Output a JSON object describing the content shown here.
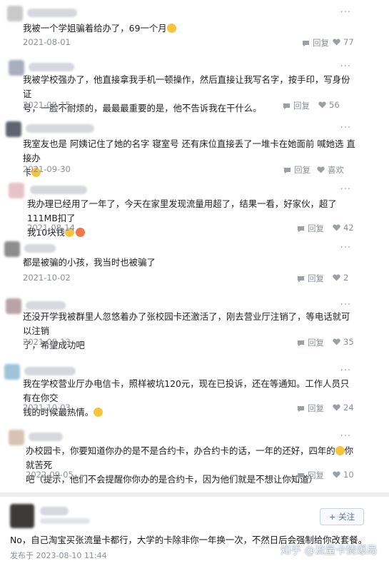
{
  "comments": [
    {
      "text": "我被一个学姐骗着给办了，69一个月",
      "emoji_after": "smile",
      "date": "2021-08-01",
      "reply_label": "回复",
      "likes": "77"
    },
    {
      "text": "我被学校强办了，他直接拿我手机一顿操作，然后直接让我写名字，按手印，写身份证\n号，一脸不耐烦的，最最最重要的是，他不告诉我在干什么。",
      "date": "2021-09-15",
      "reply_label": "回复",
      "likes": "56"
    },
    {
      "text": "我室友也是 阿姨记住了她的名字 寝室号 还有床位直接丢了一堆卡在她面前 喊她选 直接办\n卡",
      "emoji_after": "smile",
      "date": "2021-09-30",
      "reply_label": "回复",
      "likes": "喜欢"
    },
    {
      "text": "我办理已经用了一年了，今天在家里发现流量用超了，结果一看，好家伙，超了111MB扣了\n我10块钱",
      "emoji_after": "angry",
      "date": "2021-08-14",
      "reply_label": "回复",
      "likes": "42"
    },
    {
      "text": "都是被骗的小孩，我当时也被骗了",
      "date": "2021-10-02",
      "reply_label": "回复",
      "likes": "2"
    },
    {
      "text": "还没开学我被群里人忽悠着办了张校园卡还激活了，刚去营业厅注销了，等电话就可以注销\n了，希望成功吧",
      "date": "2021-08-13",
      "reply_label": "回复",
      "likes": "35"
    },
    {
      "text": "我在学校营业厅办电信卡，照样被坑120元，现在已投诉，还在等通知。工作人员只有在你交\n钱的时候最热情。",
      "emoji_after": "smile",
      "date": "2021-10-03",
      "reply_label": "回复",
      "likes": "24"
    },
    {
      "text": "办校园卡，你要知道你办的是不是合约卡，办合约卡的话，一年的还好，四年的",
      "text_b": "你就苦死\n吧（提示，他们不会提醒你你办的是合约卡，因为他们就是不想让你知道）",
      "date": "2022-09-05",
      "reply_label": "回复",
      "likes": "10"
    }
  ],
  "answer": {
    "follow_label": "+ 关注",
    "text": "No，自己淘宝买张流量卡都行，大学的卡除非你一年换一次，不然日后会强制给你改套餐。",
    "posted": "发布于 2023-08-10 11:44"
  },
  "watermark": "知乎 @流量卡情爆局",
  "colors": {
    "meta": "#8b8f99",
    "follow_border": "#c9d2e0",
    "accent": "#5d7396"
  }
}
